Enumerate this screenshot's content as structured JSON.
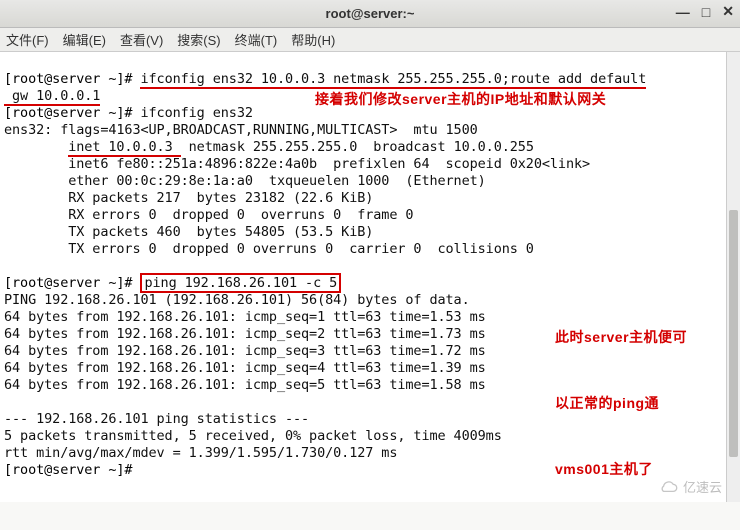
{
  "window": {
    "title": "root@server:~",
    "controls": {
      "min": "—",
      "max": "□",
      "close": "✕"
    }
  },
  "menu": {
    "file": "文件(F)",
    "edit": "编辑(E)",
    "view": "查看(V)",
    "search": "搜索(S)",
    "terminal": "终端(T)",
    "help": "帮助(H)"
  },
  "term": {
    "p1_prompt": "[root@server ~]# ",
    "p1_cmd_a": "ifconfig ens32 10.0.0.3 netmask 255.255.255.0;route add default",
    "p1_cmd_b": " gw 10.0.0.1",
    "p2_prompt": "[root@server ~]# ",
    "p2_cmd": "ifconfig ens32",
    "l_ens_flags": "ens32: flags=4163<UP,BROADCAST,RUNNING,MULTICAST>  mtu 1500",
    "l_inet_pad": "        ",
    "l_inet_a": "inet 10.0.0.3 ",
    "l_inet_b": " netmask 255.255.255.0  broadcast 10.0.0.255",
    "l_inet6": "        inet6 fe80::251a:4896:822e:4a0b  prefixlen 64  scopeid 0x20<link>",
    "l_ether": "        ether 00:0c:29:8e:1a:a0  txqueuelen 1000  (Ethernet)",
    "l_rxp": "        RX packets 217  bytes 23182 (22.6 KiB)",
    "l_rxe": "        RX errors 0  dropped 0  overruns 0  frame 0",
    "l_txp": "        TX packets 460  bytes 54805 (53.5 KiB)",
    "l_txe": "        TX errors 0  dropped 0 overruns 0  carrier 0  collisions 0",
    "l_blank": " ",
    "p3_prompt": "[root@server ~]# ",
    "p3_cmd": "ping 192.168.26.101 -c 5",
    "l_ping_hdr": "PING 192.168.26.101 (192.168.26.101) 56(84) bytes of data.",
    "l_ping1": "64 bytes from 192.168.26.101: icmp_seq=1 ttl=63 time=1.53 ms",
    "l_ping2": "64 bytes from 192.168.26.101: icmp_seq=2 ttl=63 time=1.73 ms",
    "l_ping3": "64 bytes from 192.168.26.101: icmp_seq=3 ttl=63 time=1.72 ms",
    "l_ping4": "64 bytes from 192.168.26.101: icmp_seq=4 ttl=63 time=1.39 ms",
    "l_ping5": "64 bytes from 192.168.26.101: icmp_seq=5 ttl=63 time=1.58 ms",
    "l_stats_hdr": "--- 192.168.26.101 ping statistics ---",
    "l_stats_tx": "5 packets transmitted, 5 received, 0% packet loss, time 4009ms",
    "l_stats_rtt": "rtt min/avg/max/mdev = 1.399/1.595/1.730/0.127 ms",
    "p4_prompt": "[root@server ~]# "
  },
  "annotation": {
    "a1": "接着我们修改server主机的IP地址和默认网关",
    "a2_l1": "此时server主机便可",
    "a2_l2": "以正常的ping通",
    "a2_l3": "vms001主机了"
  },
  "watermark": "亿速云"
}
